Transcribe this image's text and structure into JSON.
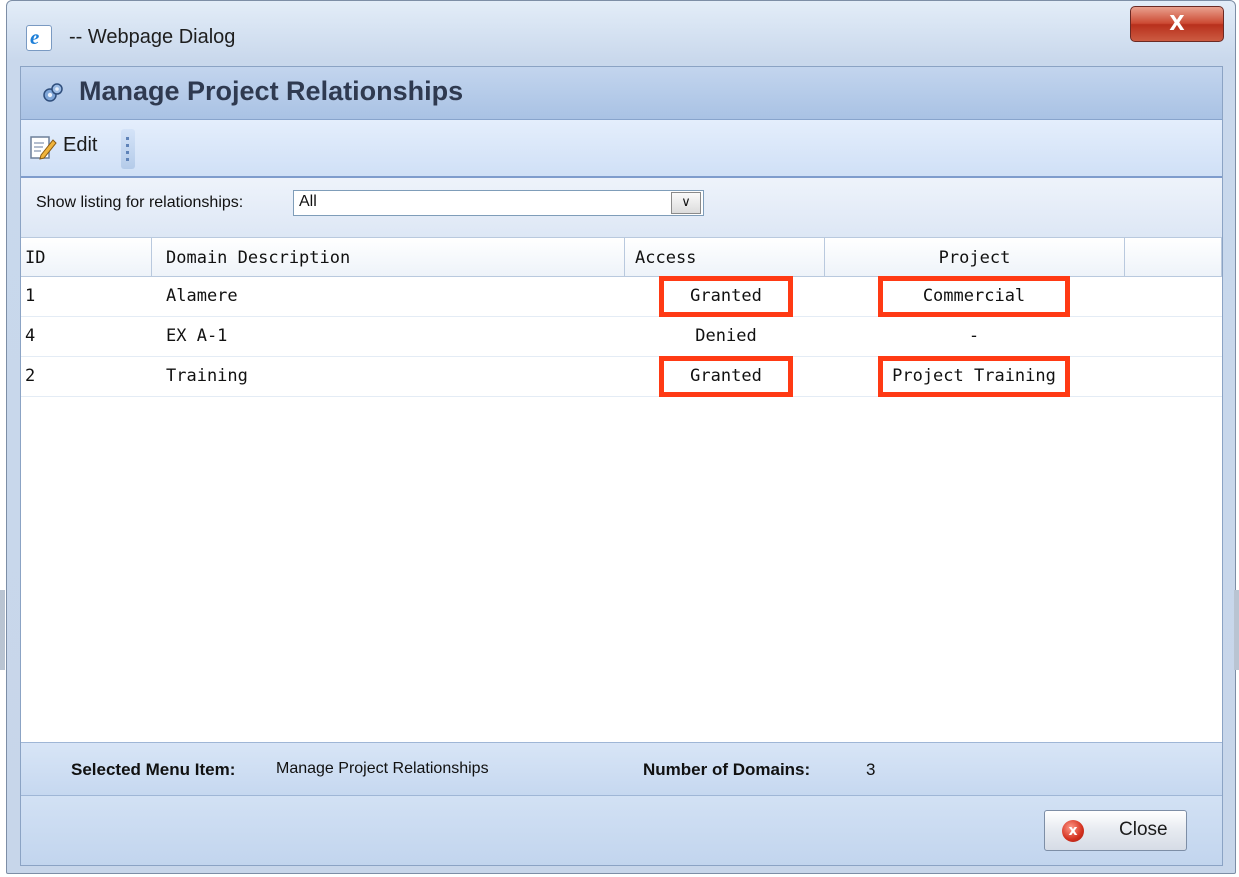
{
  "window": {
    "title": "-- Webpage Dialog",
    "close_glyph": "X"
  },
  "header": {
    "title": "Manage Project Relationships",
    "icon": "gear-icon"
  },
  "toolbar": {
    "edit_label": "Edit",
    "edit_icon": "pencil-edit-icon"
  },
  "filter": {
    "label": "Show listing for relationships:",
    "selected": "All"
  },
  "table": {
    "columns": [
      "ID",
      "Domain Description",
      "Access",
      "Project"
    ],
    "rows": [
      {
        "id": "1",
        "domain": "Alamere",
        "access": "Granted",
        "project": "Commercial"
      },
      {
        "id": "4",
        "domain": "EX A-1",
        "access": "Denied",
        "project": "-"
      },
      {
        "id": "2",
        "domain": "Training",
        "access": "Granted",
        "project": "Project Training"
      }
    ],
    "highlight_color": "#ff3a14"
  },
  "status": {
    "selected_label": "Selected Menu Item:",
    "selected_value": "Manage Project Relationships",
    "count_label": "Number of Domains:",
    "count_value": "3"
  },
  "footer": {
    "close_label": "Close",
    "close_glyph": "x"
  }
}
